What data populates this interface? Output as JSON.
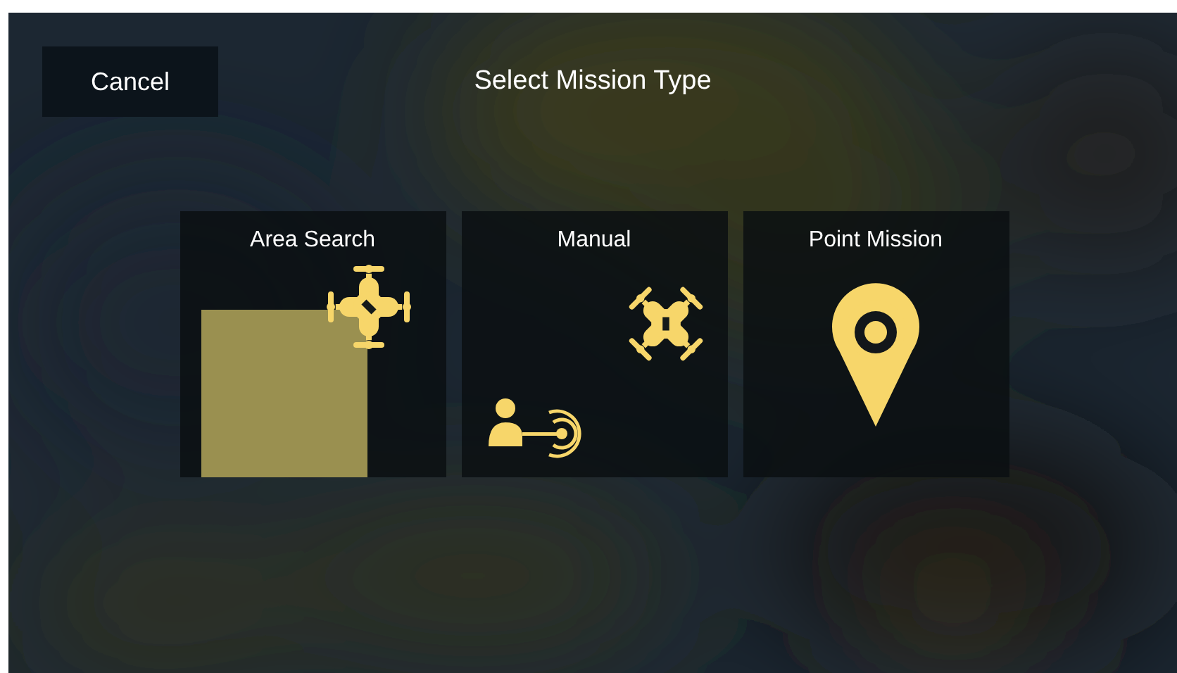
{
  "header": {
    "cancel_button": "Cancel",
    "title": "Select Mission Type"
  },
  "mission_types": [
    {
      "kind": "area",
      "label": "Area Search"
    },
    {
      "kind": "manual",
      "label": "Manual"
    },
    {
      "kind": "point",
      "label": "Point Mission"
    }
  ]
}
